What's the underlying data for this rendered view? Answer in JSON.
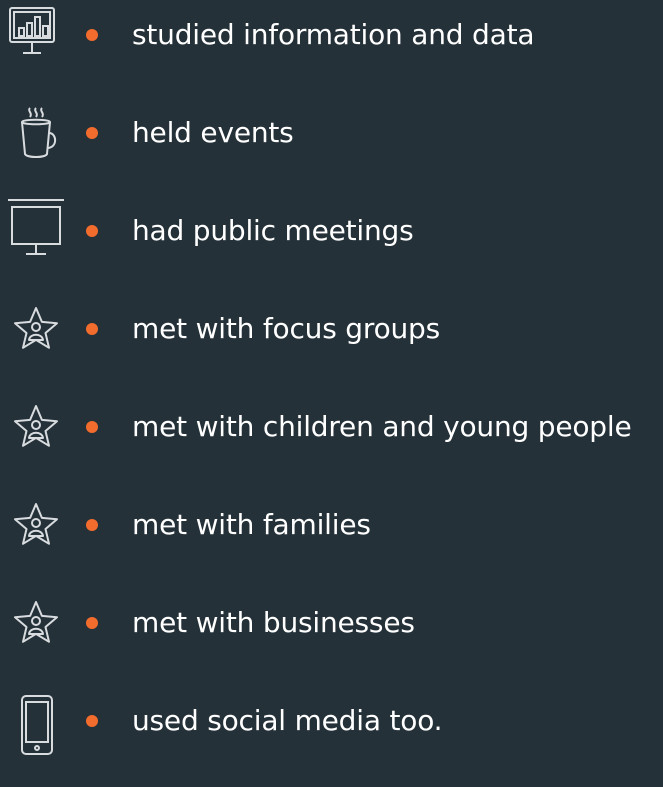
{
  "items": [
    {
      "icon": "data-chart-monitor-icon",
      "label": "studied information and data"
    },
    {
      "icon": "coffee-cup-icon",
      "label": "held events"
    },
    {
      "icon": "presentation-screen-icon",
      "label": "had public meetings"
    },
    {
      "icon": "star-person-icon",
      "label": "met with focus groups"
    },
    {
      "icon": "star-person-icon",
      "label": "met with children and young people"
    },
    {
      "icon": "star-person-icon",
      "label": "met with families"
    },
    {
      "icon": "star-person-icon",
      "label": "met with businesses"
    },
    {
      "icon": "mobile-phone-icon",
      "label": "used social media too."
    }
  ],
  "colors": {
    "background": "#243139",
    "bullet": "#f26c2d",
    "text": "#ffffff",
    "icon": "#d8dcdf"
  }
}
